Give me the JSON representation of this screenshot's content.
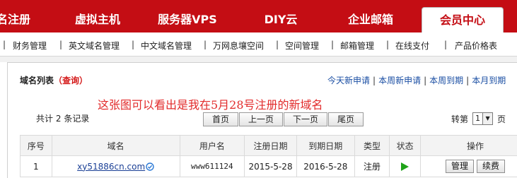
{
  "topnav": {
    "tabs": [
      {
        "label": "名注册"
      },
      {
        "label": "虚拟主机"
      },
      {
        "label": "服务器VPS"
      },
      {
        "label": "DIY云"
      },
      {
        "label": "企业邮箱"
      },
      {
        "label": "会员中心"
      }
    ]
  },
  "subnav": {
    "items": [
      "财务管理",
      "英文域名管理",
      "中文域名管理",
      "万网息壤空间",
      "空间管理",
      "邮箱管理",
      "在线支付",
      "产品价格表"
    ]
  },
  "panel": {
    "title": "域名列表",
    "query_link": "（查询）",
    "quick_links": [
      "今天新申请",
      "本周新申请",
      "本周到期",
      "本月到期"
    ]
  },
  "annotation": "这张图可以看出是我在5月28号注册的新域名",
  "listing": {
    "count_prefix": "共计",
    "count": "2",
    "count_suffix": "条记录",
    "pager": [
      "首页",
      "上一页",
      "下一页",
      "尾页"
    ],
    "jump_label": "转第",
    "jump_page": "1",
    "jump_suffix": "页"
  },
  "table": {
    "headers": [
      "序号",
      "域名",
      "用户名",
      "注册日期",
      "到期日期",
      "类型",
      "状态",
      "操作"
    ],
    "rows": [
      {
        "index": "1",
        "domain": "xy51886cn.com",
        "username": "www611124",
        "reg_date": "2015-5-28",
        "exp_date": "2016-5-28",
        "type": "注册",
        "status_icon": "play-icon",
        "actions": [
          "管理",
          "续费"
        ]
      }
    ]
  },
  "colors": {
    "brand_red": "#c40d14",
    "link_blue": "#1a4ea3",
    "annotation_red": "#e22b2b",
    "status_green": "#1fa319"
  }
}
